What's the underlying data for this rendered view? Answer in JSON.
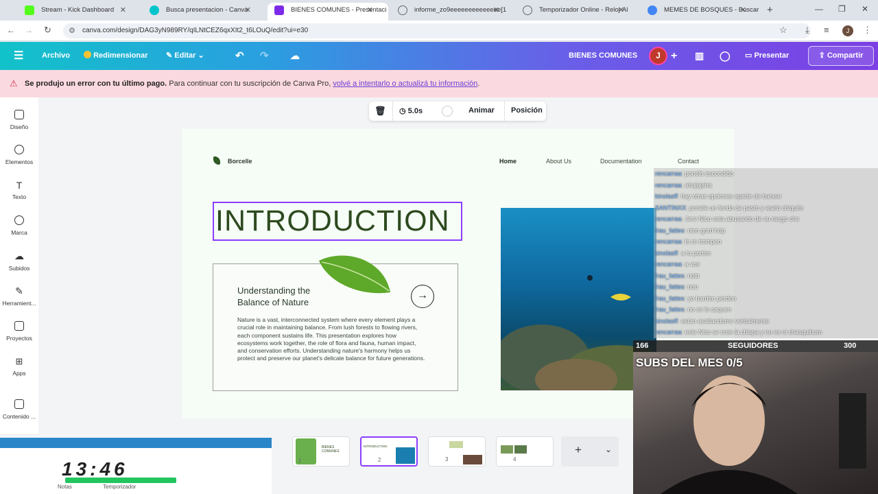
{
  "browser": {
    "tabs": [
      {
        "title": "Stream - Kick Dashboard",
        "color": "#53fc18"
      },
      {
        "title": "Busca presentacion - Canva",
        "color": "#00c4cc"
      },
      {
        "title": "BIENES COMUNES - Presentaci",
        "color": "#7d2ae8"
      },
      {
        "title": "informe_zo9eeeeeeeeeeeeee[1",
        "color": "#888888"
      },
      {
        "title": "Temporizador Online - Reloj-Al",
        "color": "#888888"
      },
      {
        "title": "MEMES DE BOSQUES - Buscar",
        "color": "#4285f4"
      }
    ],
    "url": "canva.com/design/DAG3yN989RY/qILNtCEZ6qxXIt2_t6LOuQ/edit?ui=e30"
  },
  "canva": {
    "menu": {
      "archivo": "Archivo",
      "redimensionar": "Redimensionar",
      "editar": "Editar"
    },
    "design_title": "BIENES COMUNES",
    "avatar": "J",
    "presentar": "Presentar",
    "compartir": "Compartir",
    "error": {
      "bold": "Se produjo un error con tu último pago.",
      "text": "Para continuar con tu suscripción de Canva Pro,",
      "link": "volvé a intentarlo o actualizá tu información",
      "end": "."
    },
    "rail": [
      "Diseño",
      "Elementos",
      "Texto",
      "Marca",
      "Subidos",
      "Herramient...",
      "Proyectos",
      "Apps",
      "Contenido ..."
    ],
    "toolbar": {
      "duration": "5.0s",
      "animar": "Animar",
      "posicion": "Posición"
    },
    "slide": {
      "brand": "Borcelle",
      "nav": [
        "Home",
        "About Us",
        "Documentation",
        "Contact"
      ],
      "title": "INTRODUCTION",
      "card_title": "Understanding the Balance of Nature",
      "card_body": "Nature is a vast, interconnected system where every element plays a crucial role in maintaining balance. From lush forests to flowing rivers, each component sustains life. This presentation explores how ecosystems work together, the role of flora and fauna, human impact, and conservation efforts. Understanding nature's harmony helps us protect and preserve our planet's delicate balance for future generations."
    },
    "pages": [
      "1",
      "2",
      "3",
      "4"
    ],
    "thumb1_text": "BIENES COMUNES",
    "thumb2_text": "INTRODUCTION"
  },
  "chat": [
    {
      "user": "rencarraa",
      "msg": ": ponelo escondido"
    },
    {
      "user": "rencarraa",
      "msg": ": ahajajaha"
    },
    {
      "user": "kinolasff",
      "msg": ": hay otras opciones aparte de banear"
    },
    {
      "user": "SANTINXX",
      "msg": ": ponele un fondo de pasto y aselo chiquito"
    },
    {
      "user": "rencarraa",
      "msg": ": Jere Nico esta abusando de su rango che"
    },
    {
      "user": "frau_fattes",
      "msg": ": nico gord hdp"
    },
    {
      "user": "rencarraa",
      "msg": ": lo re trompeo"
    },
    {
      "user": "kinolasff",
      "msg": ": a tu porton"
    },
    {
      "user": "rencarraa",
      "msg": ": a vos"
    },
    {
      "user": "frau_fattes",
      "msg": ": nolo"
    },
    {
      "user": "frau_fattes",
      "msg": ": noo"
    },
    {
      "user": "frau_fattes",
      "msg": ": yo bardee perdon"
    },
    {
      "user": "frau_fattes",
      "msg": ": no se lo saquen"
    },
    {
      "user": "kinolasff",
      "msg": ": estan asaltandome verbalmente"
    },
    {
      "user": "rencarraa",
      "msg": ": este Nico se cree la chispa y no es ni chasquibum"
    }
  ],
  "stream": {
    "followers_current": "166",
    "followers_label": "SEGUIDORES",
    "followers_goal": "300",
    "subs": "SUBS DEL MES 0/5"
  },
  "timer": {
    "time": "13:46",
    "notas": "Notas",
    "temporizador": "Temporizador"
  }
}
